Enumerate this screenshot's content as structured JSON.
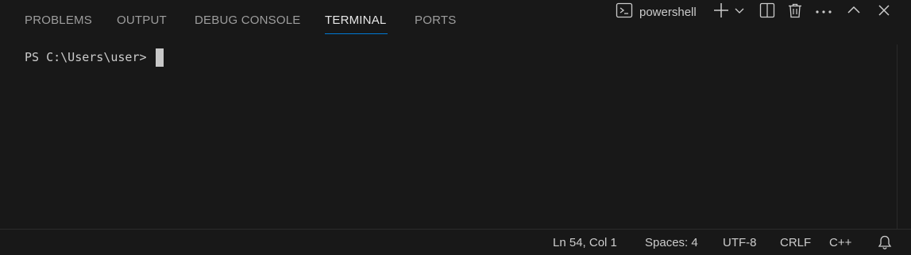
{
  "panel": {
    "tabs": [
      {
        "label": "PROBLEMS"
      },
      {
        "label": "OUTPUT"
      },
      {
        "label": "DEBUG CONSOLE"
      },
      {
        "label": "TERMINAL"
      },
      {
        "label": "PORTS"
      }
    ],
    "active_tab": "TERMINAL",
    "actions": {
      "shell_label": "powershell",
      "icons": [
        "terminal-icon",
        "add-icon",
        "chevron-down-icon",
        "split-icon",
        "trash-icon",
        "more-icon",
        "chevron-up-icon",
        "close-icon"
      ]
    }
  },
  "terminal": {
    "prompt": "PS C:\\Users\\user>"
  },
  "statusbar": {
    "position": "Ln 54, Col 1",
    "spaces": "Spaces: 4",
    "encoding": "UTF-8",
    "eol": "CRLF",
    "language": "C++",
    "bell_icon": "bell-icon"
  },
  "colors": {
    "background": "#181818",
    "accent": "#0078d4",
    "text": "#cccccc"
  }
}
